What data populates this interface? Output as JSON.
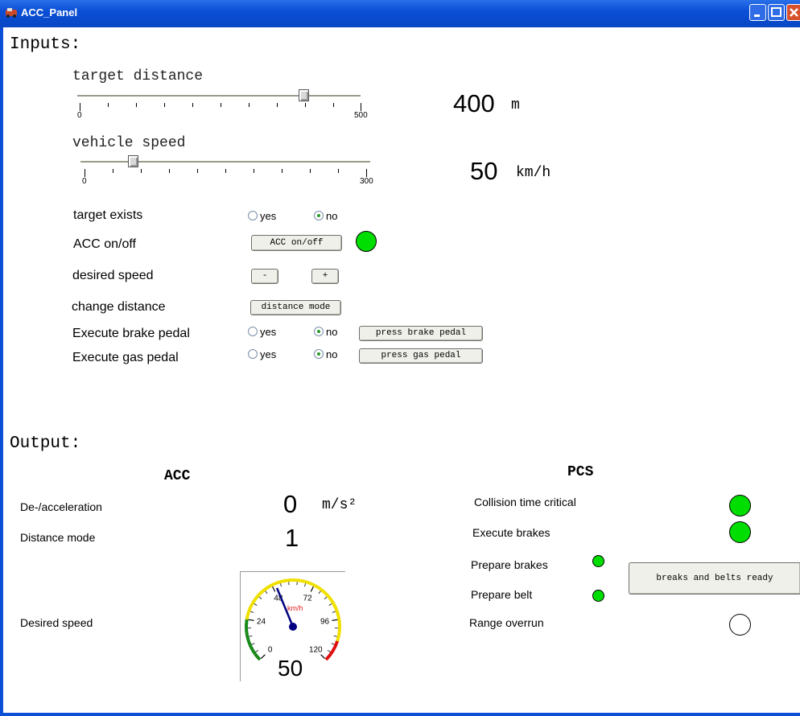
{
  "window": {
    "title": "ACC_Panel"
  },
  "inputs": {
    "heading": "Inputs:",
    "target_distance": {
      "label": "target distance",
      "min": "0",
      "max": "500",
      "value": "400",
      "unit": "m",
      "fraction": 0.8
    },
    "vehicle_speed": {
      "label": "vehicle speed",
      "min": "0",
      "max": "300",
      "value": "50",
      "unit": "km/h",
      "fraction": 0.167
    },
    "target_exists": {
      "label": "target exists",
      "yes": "yes",
      "no": "no",
      "selected": "no"
    },
    "acc_onoff": {
      "label": "ACC on/off",
      "button": "ACC on/off",
      "led_color": "#00dd00"
    },
    "desired_speed": {
      "label": "desired speed",
      "minus": "-",
      "plus": "+"
    },
    "change_distance": {
      "label": "change distance",
      "button": "distance mode"
    },
    "brake_pedal": {
      "label": "Execute brake pedal",
      "yes": "yes",
      "no": "no",
      "selected": "no",
      "button": "press brake pedal"
    },
    "gas_pedal": {
      "label": "Execute gas pedal",
      "yes": "yes",
      "no": "no",
      "selected": "no",
      "button": "press gas pedal"
    }
  },
  "output": {
    "heading": "Output:",
    "acc": {
      "title": "ACC",
      "deceleration": {
        "label": "De-/acceleration",
        "value": "0",
        "unit": "m/s²"
      },
      "distance_mode": {
        "label": "Distance mode",
        "value": "1"
      },
      "desired_speed": {
        "label": "Desired speed",
        "gauge_unit": "km/h",
        "gauge_ticks": [
          "0",
          "24",
          "48",
          "72",
          "96",
          "120"
        ],
        "gauge_value": 50,
        "value": "50"
      }
    },
    "pcs": {
      "title": "PCS",
      "collision_time_critical": {
        "label": "Collision time critical",
        "led_color": "#00dd00"
      },
      "execute_brakes": {
        "label": "Execute brakes",
        "led_color": "#00dd00"
      },
      "prepare_brakes": {
        "label": "Prepare brakes",
        "led_color": "#00dd00"
      },
      "prepare_belt": {
        "label": "Prepare belt",
        "led_color": "#00dd00"
      },
      "range_overrun": {
        "label": "Range overrun",
        "led_color": "#ffffff"
      },
      "ready_button": "breaks and belts ready"
    }
  }
}
